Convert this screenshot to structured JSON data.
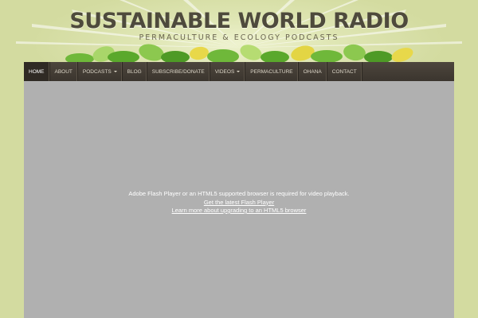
{
  "site": {
    "title": "SUSTAINABLE WORLD RADIO",
    "tagline": "PERMACULTURE & ECOLOGY PODCASTS"
  },
  "colors": {
    "background": "#d3dba0",
    "nav_bg": "#3f3831",
    "nav_active": "#2f2a24",
    "video_bg": "#b0b0b0",
    "title_text": "#4e4a3c",
    "leaf_green": "#5aa82c"
  },
  "nav": {
    "items": [
      {
        "label": "HOME",
        "active": true
      },
      {
        "label": "ABOUT"
      },
      {
        "label": "PODCASTS",
        "dropdown": true
      },
      {
        "label": "BLOG"
      },
      {
        "label": "SUBSCRIBE/DONATE"
      },
      {
        "label": "VIDEOS",
        "dropdown": true
      },
      {
        "label": "PERMACULTURE"
      },
      {
        "label": "OHANA"
      },
      {
        "label": "CONTACT"
      }
    ]
  },
  "video": {
    "message": "Adobe Flash Player or an HTML5 supported browser is required for video playback.",
    "link_flash": "Get the latest Flash Player",
    "link_html5": "Learn more about upgrading to an HTML5 browser"
  }
}
